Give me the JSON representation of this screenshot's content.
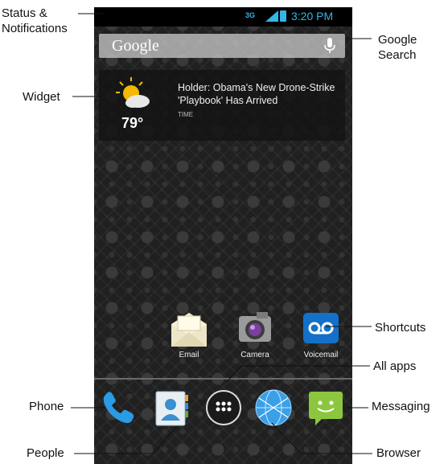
{
  "annotations": {
    "status_notifications": "Status &\nNotifications",
    "widget": "Widget",
    "google_search": "Google\nSearch",
    "shortcuts": "Shortcuts",
    "all_apps": "All apps",
    "phone": "Phone",
    "messaging": "Messaging",
    "people": "People",
    "browser": "Browser"
  },
  "status_bar": {
    "network": "3G",
    "time": "3:20 PM"
  },
  "search": {
    "logo": "Google"
  },
  "widget": {
    "temperature": "79°",
    "headline": "Holder: Obama's New Drone-Strike 'Playbook' Has Arrived",
    "source": "TIME"
  },
  "shortcuts": [
    {
      "label": "Email",
      "icon": "email-icon"
    },
    {
      "label": "Camera",
      "icon": "camera-icon"
    },
    {
      "label": "Voicemail",
      "icon": "voicemail-icon"
    }
  ],
  "dock": [
    {
      "name": "Phone",
      "icon": "phone-icon"
    },
    {
      "name": "People",
      "icon": "contacts-icon"
    },
    {
      "name": "All apps",
      "icon": "all-apps-icon"
    },
    {
      "name": "Browser",
      "icon": "browser-globe-icon"
    },
    {
      "name": "Messaging",
      "icon": "messaging-icon"
    }
  ],
  "colors": {
    "status_accent": "#33b5e5",
    "wallpaper": "#202020"
  }
}
